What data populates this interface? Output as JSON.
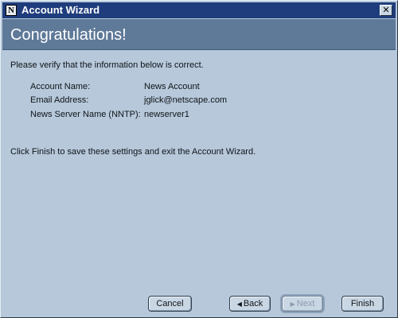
{
  "window": {
    "title": "Account Wizard",
    "app_icon_glyph": "N",
    "close_glyph": "✕"
  },
  "header": {
    "title": "Congratulations!"
  },
  "content": {
    "intro": "Please verify that the information below is correct.",
    "fields": [
      {
        "label": "Account Name:",
        "value": "News Account"
      },
      {
        "label": "Email Address:",
        "value": "jglick@netscape.com"
      },
      {
        "label": "News Server Name (NNTP):",
        "value": "newserver1"
      }
    ],
    "finish_note": "Click Finish to save these settings and exit the Account Wizard."
  },
  "buttons": {
    "cancel": "Cancel",
    "back": "Back",
    "back_arrow": "◀",
    "next": "Next",
    "next_arrow": "▶",
    "finish": "Finish"
  },
  "colors": {
    "titlebar": "#1f3d7c",
    "header_band": "#5f7998",
    "dialog_background": "#b6c8da"
  }
}
